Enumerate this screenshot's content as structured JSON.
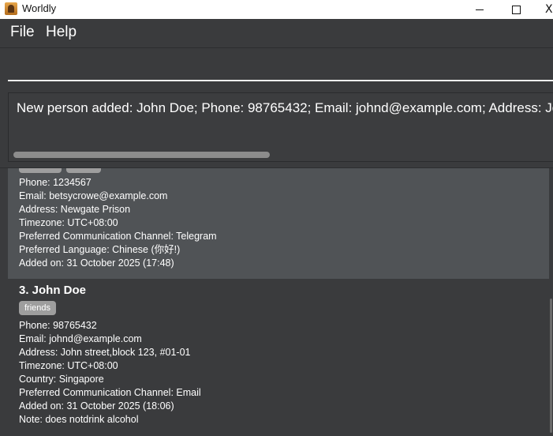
{
  "window": {
    "title": "Worldly",
    "minimize_icon": "minimize-icon",
    "maximize_icon": "maximize-icon",
    "close_icon": "close-icon",
    "close_glyph": "X"
  },
  "menu": {
    "items": [
      {
        "label": "File"
      },
      {
        "label": "Help"
      }
    ]
  },
  "command": {
    "value": "",
    "placeholder": ""
  },
  "result": {
    "text": "New person added: John Doe; Phone: 98765432; Email: johnd@example.com; Address: John s"
  },
  "people": [
    {
      "selected": true,
      "fields": [
        "Phone: 1234567",
        "Email: betsycrowe@example.com",
        "Address: Newgate Prison",
        "Timezone: UTC+08:00",
        "Preferred Communication Channel: Telegram",
        "Preferred Language: Chinese (你好!)",
        "Added on: 31 October 2025 (17:48)"
      ]
    },
    {
      "selected": false,
      "name": "3. John Doe",
      "tags": [
        "friends"
      ],
      "fields": [
        "Phone: 98765432",
        "Email: johnd@example.com",
        "Address: John street,block 123, #01-01",
        "Timezone: UTC+08:00",
        "Country: Singapore",
        "Preferred Communication Channel: Email",
        "Added on: 31 October 2025 (18:06)",
        "Note: does notdrink alcohol"
      ]
    }
  ],
  "colors": {
    "background": "#3a3b3d",
    "selected_card": "#505356",
    "tag": "#9e9e9e",
    "text": "#ffffff"
  }
}
